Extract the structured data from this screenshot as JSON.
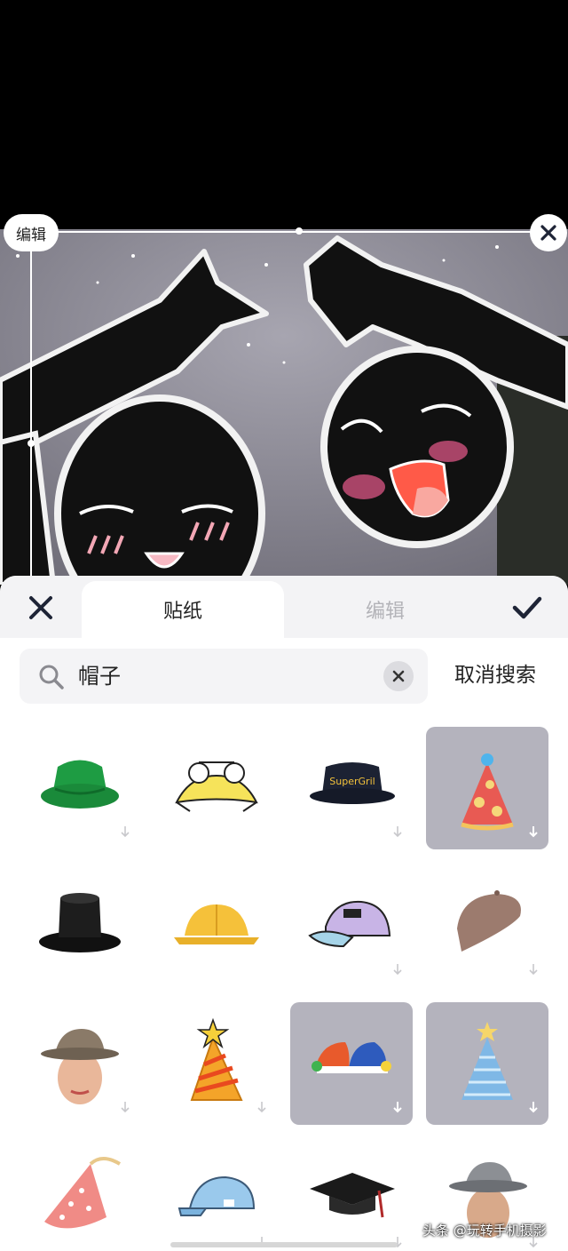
{
  "overlay": {
    "edit_label": "编辑"
  },
  "tabs": [
    {
      "label": "贴纸",
      "active": true
    },
    {
      "label": "编辑",
      "active": false
    }
  ],
  "search": {
    "value": "帽子",
    "cancel_label": "取消搜索"
  },
  "stickers": [
    {
      "name": "green-bucket-hat",
      "selected": false
    },
    {
      "name": "yellow-frog-hat",
      "selected": false
    },
    {
      "name": "navy-bucket-hat-supergril",
      "label": "SuperGril",
      "selected": false
    },
    {
      "name": "red-party-hat-dots",
      "selected": true
    },
    {
      "name": "black-top-hat",
      "selected": false
    },
    {
      "name": "yellow-safety-cap",
      "selected": false
    },
    {
      "name": "holographic-cap",
      "selected": false
    },
    {
      "name": "brown-beret",
      "selected": false
    },
    {
      "name": "man-fedora",
      "selected": false
    },
    {
      "name": "orange-star-party-hat",
      "selected": false
    },
    {
      "name": "jester-hat",
      "selected": true
    },
    {
      "name": "blue-star-party-hat",
      "selected": true
    },
    {
      "name": "pink-dotted-party-hat",
      "selected": false
    },
    {
      "name": "light-blue-cap",
      "selected": false
    },
    {
      "name": "graduation-cap",
      "selected": false
    },
    {
      "name": "man-gray-fedora",
      "selected": false
    }
  ],
  "watermark": "头条 @玩转手机摄影",
  "colors": {
    "accent": "#1e2436",
    "selected_bg": "#b4b3bd",
    "tab_inactive": "#b3b3b8"
  }
}
